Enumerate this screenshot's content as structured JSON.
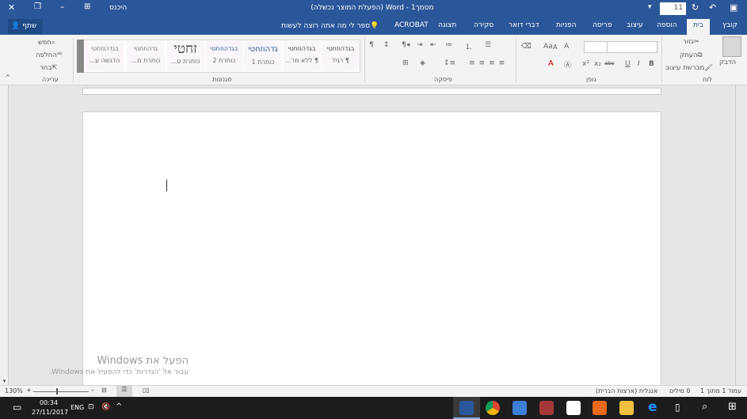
{
  "titlebar": {
    "title": "מסמך1 - Word (הפעלת המוצר נכשלה)",
    "signin": "היכנס",
    "font_size_qat": "11"
  },
  "tabs": [
    "קובץ",
    "בית",
    "הוספה",
    "עיצוב",
    "פריסה",
    "הפניות",
    "דברי דואר",
    "סקירה",
    "תצוגה",
    "ACROBAT"
  ],
  "tell_me": "ספר לי מה אתה רוצה לעשות",
  "share": "שתף",
  "clipboard": {
    "paste": "הדבק",
    "cut": "גזור",
    "copy": "העתק",
    "format_painter": "מברשת עיצוב",
    "group": "לוח"
  },
  "font": {
    "group": "גופן",
    "bold": "B",
    "italic": "I",
    "underline": "U",
    "strike": "abc",
    "sub": "x₂",
    "sup": "x²",
    "grow": "A",
    "shrink": "A",
    "case": "Aa"
  },
  "paragraph": {
    "group": "פיסקה"
  },
  "styles": {
    "group": "סגנונות",
    "items": [
      {
        "preview": "בגדהוזחטי",
        "name": "¶ רגיל"
      },
      {
        "preview": "בגדהוזחטי",
        "name": "¶ ללא מר..."
      },
      {
        "preview": "גדהוזחטי",
        "name": "כותרת 1"
      },
      {
        "preview": "בגדהוזחטי",
        "name": "כותרת 2"
      },
      {
        "preview": "זחטי",
        "name": "כותרת ט..."
      },
      {
        "preview": "גדהוזחטי",
        "name": "כותרת מ..."
      },
      {
        "preview": "בגדהוזחטי",
        "name": "הדגשה ע..."
      }
    ]
  },
  "editing": {
    "find": "חפש",
    "replace": "החלפה",
    "select": "בחר",
    "group": "עריכה"
  },
  "watermark": {
    "line1": "הפעל את Windows",
    "line2": "עבור אל 'הגדרות' כדי להפעיל את Windows."
  },
  "status": {
    "page": "עמוד 1 מתוך 1",
    "words": "0 מילים",
    "language": "אנגלית (ארצות הברית)",
    "zoom": "130%"
  },
  "taskbar": {
    "time": "00:34",
    "date": "27/11/2017",
    "lang": "ENG"
  },
  "colors": {
    "accent": "#2b579a",
    "taskbar": "#1c1c1c"
  }
}
